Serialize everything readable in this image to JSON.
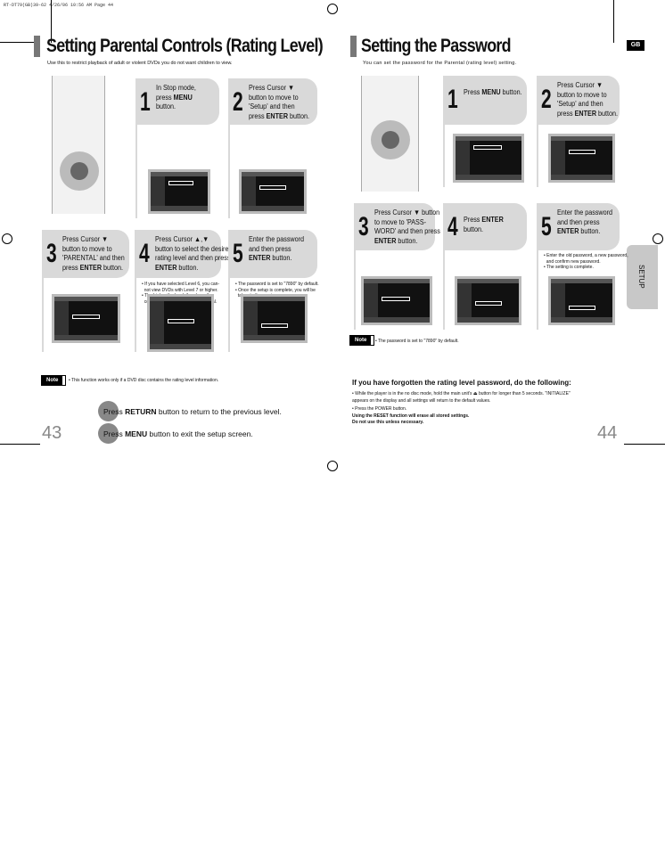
{
  "slug": "RT-DT79(GB)39-62   4/26/06   10:56 AM   Page 44",
  "left": {
    "title": "Setting Parental Controls (Rating Level)",
    "subtitle": "Use this to restrict playback of adult or violent DVDs you do not want children to view.",
    "steps": [
      {
        "num": "1",
        "lines": [
          "In Stop mode,",
          "press MENU",
          "button."
        ]
      },
      {
        "num": "2",
        "lines": [
          "Press Cursor ▼",
          "button to move to",
          "'Setup' and then",
          "press ENTER button."
        ]
      },
      {
        "num": "3",
        "lines": [
          "Press Cursor ▼",
          "button to move to",
          "'PARENTAL' and then",
          "press ENTER button."
        ]
      },
      {
        "num": "4",
        "lines": [
          "Press Cursor ▲,▼",
          "button to select the desired",
          "rating level and then press",
          "ENTER button."
        ],
        "bullets": [
          "• If you have selected Level 6, you can-",
          "  not view DVDs with Level 7 or higher.",
          "• The higher the level, the closer the",
          "  content is to violent or adult material."
        ]
      },
      {
        "num": "5",
        "lines": [
          "Enter the password",
          "and then press",
          "ENTER button."
        ],
        "bullets": [
          "• The password is set to \"7890\" by default.",
          "• Once the setup is complete, you will be",
          "  taken to the previous screen."
        ]
      }
    ],
    "note_label": "Note",
    "note": "• This function works only if a DVD disc contains the rating level information.",
    "tips": [
      "Press RETURN button to return to the previous level.",
      "Press MENU button to exit the setup screen."
    ],
    "page": "43"
  },
  "right": {
    "title": "Setting the Password",
    "subtitle": "You can set the password for the Parental (rating level) setting.",
    "badge": "GB",
    "side_tab": "SETUP",
    "steps": [
      {
        "num": "1",
        "lines": [
          "Press MENU button."
        ]
      },
      {
        "num": "2",
        "lines": [
          "Press Cursor ▼",
          "button to move to",
          "'Setup' and then",
          "press ENTER button."
        ]
      },
      {
        "num": "3",
        "lines": [
          "Press Cursor ▼ button",
          "to move to 'PASS-",
          "WORD' and then press",
          "ENTER button."
        ]
      },
      {
        "num": "4",
        "lines": [
          "Press ENTER",
          "button."
        ]
      },
      {
        "num": "5",
        "lines": [
          "Enter the password",
          "and then press",
          "ENTER button."
        ],
        "bullets": [
          "• Enter the old password, a new password,",
          "  and confirm new password.",
          "• The setting is complete."
        ]
      }
    ],
    "note_label": "Note",
    "note": "• The password is set to \"7890\" by default.",
    "forgot_heading": "If you have forgotten the rating level password, do the following:",
    "forgot_lines": [
      "• While the player is in the no disc mode, hold the main unit's  ⏏  button for longer than 5 seconds. \"INITIALIZE\"",
      "  appears on the display and all settings will return to the default values.",
      "• Press the POWER button."
    ],
    "warning": [
      "Using the RESET function will erase all stored settings.",
      "Do not use this unless necessary."
    ],
    "page": "44"
  }
}
